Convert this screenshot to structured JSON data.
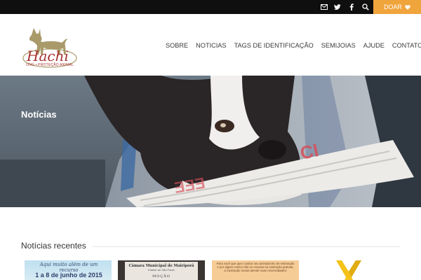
{
  "topbar": {
    "icons": [
      "mail-icon",
      "twitter-icon",
      "facebook-icon",
      "search-icon"
    ],
    "donate_label": "DOAR"
  },
  "logo": {
    "name": "Hachi",
    "tagline": "ONG • PROTEÇÃO ANIMAL"
  },
  "nav": {
    "items": [
      "SOBRE",
      "NOTICIAS",
      "TAGS DE IDENTIFICAÇÃO",
      "SEMIJOIAS",
      "AJUDE",
      "CONTATO"
    ]
  },
  "hero": {
    "title": "Notícias"
  },
  "recent": {
    "title": "Notícias recentes",
    "thumbs": [
      {
        "line1": "Aqui muito além de um recurso",
        "line2": "1 a 8 de junho de 2015"
      },
      {
        "line1": "Câmara Municipal de Mairiporã",
        "line2": "Estado de São Paulo",
        "line3": "MOÇÃO"
      },
      {
        "line1": "Para você que quer castrar seu animalzinho de estimação e por algum motivo não se encaixa na castração gratuita, a Castração Social atende suas necessidades!"
      },
      {
        "line1": ""
      }
    ]
  },
  "colors": {
    "topbar": "#0f0f0f",
    "donate": "#f0a43c",
    "brand": "#a6302f",
    "ribbon": "#f4c21a"
  }
}
